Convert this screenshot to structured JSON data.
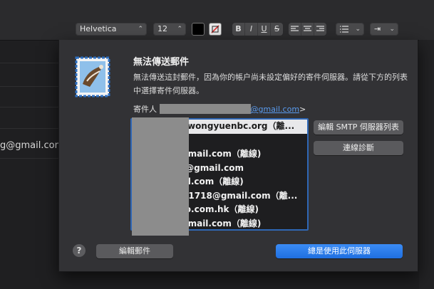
{
  "toolbar": {
    "font_family": "Helvetica",
    "font_size": "12",
    "bold": "B",
    "italic": "I",
    "underline": "U",
    "strike": "S",
    "indent_glyph": "⇥"
  },
  "background": {
    "fragment_text": "g@gmail.com"
  },
  "dialog": {
    "title": "無法傳送郵件",
    "description": "無法傳送這封郵件，因為你的帳户尚未設定偏好的寄件伺服器。請從下方的列表中選擇寄件伺服器。",
    "sender_label": "寄件人",
    "sender_domain": "@gmail.com",
    "sender_suffix": ">",
    "servers": [
      "@kwongyuenbc.org（離...",
      ")",
      "@gmail.com（離線)",
      "ng@gmail.com",
      "nail.com（離線)",
      "nts1718@gmail.com（離...",
      "hoo.com.hk（離線)",
      "@gmail.com（離線)"
    ],
    "edit_smtp_button": "編輯 SMTP 伺服器列表",
    "diagnostics_button": "連線診斷",
    "help_label": "?",
    "edit_mail_button": "編輯郵件",
    "always_use_button": "總是使用此伺服器"
  }
}
